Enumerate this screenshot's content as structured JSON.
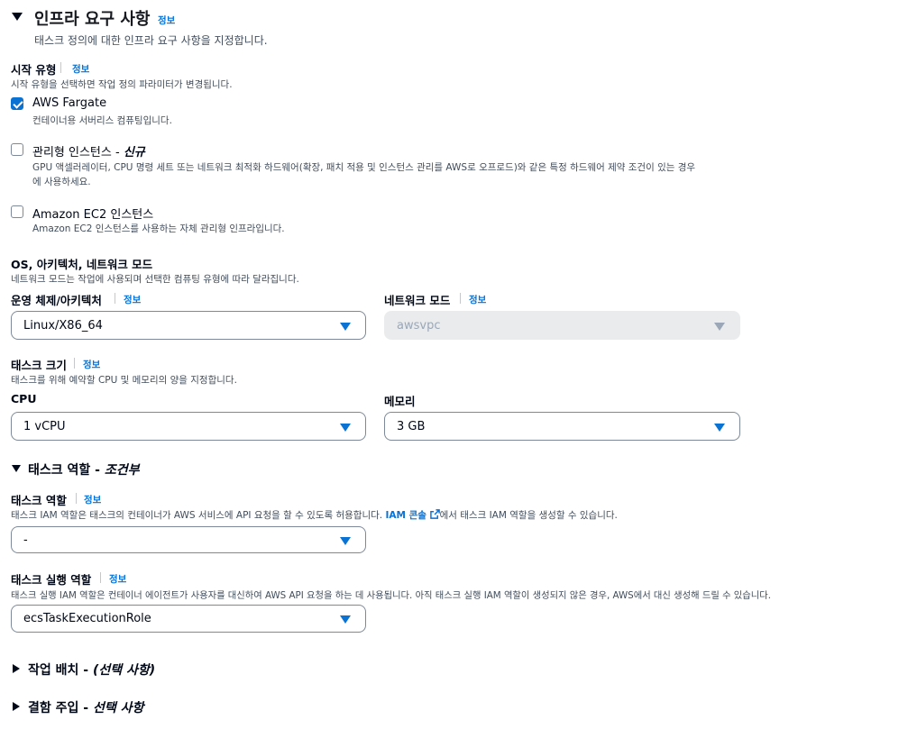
{
  "section": {
    "title": "인프라 요구 사항",
    "info": "정보",
    "description": "태스크 정의에 대한 인프라 요구 사항을 지정합니다."
  },
  "launch_type": {
    "label": "시작 유형",
    "info": "정보",
    "description": "시작 유형을 선택하면 작업 정의 파라미터가 변경됩니다.",
    "options": [
      {
        "title": "AWS Fargate",
        "title_suffix": "",
        "description": "컨테이너용 서버리스 컴퓨팅입니다.",
        "checked": true
      },
      {
        "title": "관리형 인스턴스 -",
        "title_suffix": "신규",
        "description": "GPU 액셀러레이터, CPU 명령 세트 또는 네트워크 최적화 하드웨어(확장, 패치 적용 및 인스턴스 관리를 AWS로 오프로드)와 같은 특정 하드웨어 제약 조건이 있는 경우",
        "description_2": "에 사용하세요.",
        "checked": false
      },
      {
        "title": "Amazon EC2 인스턴스",
        "title_suffix": "",
        "description": "Amazon EC2 인스턴스를 사용하는 자체 관리형 인프라입니다.",
        "checked": false
      }
    ]
  },
  "os_arch": {
    "title": "OS, 아키텍처, 네트워크 모드",
    "description": "네트워크 모드는 작업에 사용되며 선택한 컴퓨팅 유형에 따라 달라집니다.",
    "os_label": "운영 체제/아키텍처",
    "os_info": "정보",
    "os_value": "Linux/X86_64",
    "network_label": "네트워크 모드",
    "network_info": "정보",
    "network_value": "awsvpc"
  },
  "task_size": {
    "title": "태스크 크기",
    "info": "정보",
    "description": "태스크를 위해 예약할 CPU 및 메모리의 양을 지정합니다.",
    "cpu_label": "CPU",
    "cpu_value": "1 vCPU",
    "memory_label": "메모리",
    "memory_value": "3 GB"
  },
  "task_roles": {
    "title": "태스크 역할 -",
    "title_suffix": "조건부",
    "role_label": "태스크 역할",
    "role_info": "정보",
    "role_desc_pre": "태스크 IAM 역할은 태스크의 컨테이너가 AWS 서비스에 API 요청을 할 수 있도록 허용합니다.",
    "role_desc_link": "IAM 콘솔",
    "role_desc_post": "에서 태스크 IAM 역할을 생성할 수 있습니다.",
    "role_value": "-",
    "exec_label": "태스크 실행 역할",
    "exec_info": "정보",
    "exec_desc": "태스크 실행 IAM 역할은 컨테이너 에이전트가 사용자를 대신하여 AWS API 요청을 하는 데 사용됩니다. 아직 태스크 실행 IAM 역할이 생성되지 않은 경우, AWS에서 대신 생성해 드릴 수 있습니다.",
    "exec_value": "ecsTaskExecutionRole"
  },
  "placement": {
    "title": "작업 배치 -",
    "title_suffix": "(선택 사항)"
  },
  "fault_injection": {
    "title": "결함 주입 -",
    "title_suffix": "선택 사항"
  },
  "colors": {
    "accent": "#0972d3",
    "checkbox_checked": "#0972d3",
    "text": "#000716",
    "secondary_text": "#414d5c"
  }
}
